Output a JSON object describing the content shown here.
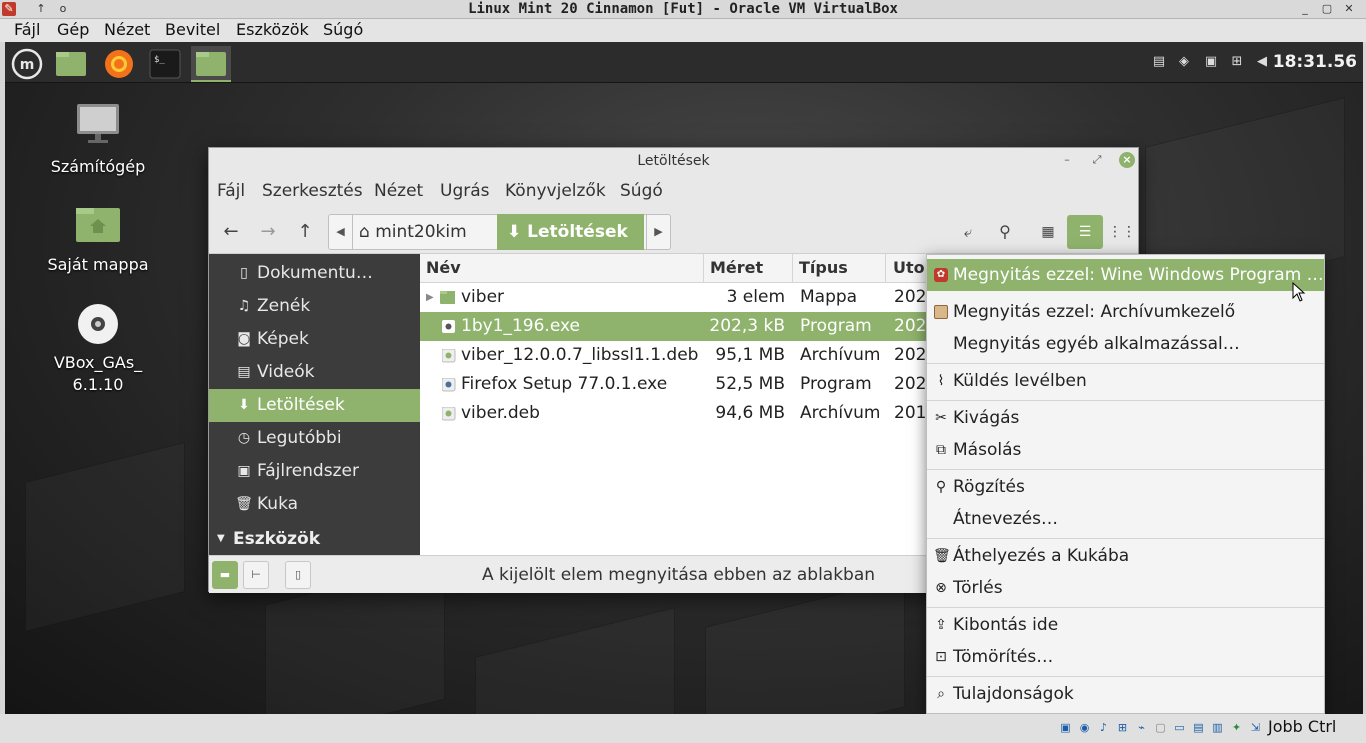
{
  "host": {
    "title": "Linux Mint 20 Cinnamon [Fut] - Oracle VM VirtualBox",
    "menu": [
      "Fájl",
      "Gép",
      "Nézet",
      "Bevitel",
      "Eszközök",
      "Súgó"
    ],
    "host_key": "Jobb Ctrl"
  },
  "panel": {
    "clock": "18:31.56"
  },
  "desktop": {
    "icons": [
      {
        "label": "Számítógép",
        "icon": "computer-icon"
      },
      {
        "label": "Saját mappa",
        "icon": "home-folder-icon"
      },
      {
        "label": "VBox_GAs_\n6.1.10",
        "line1": "VBox_GAs_",
        "line2": "6.1.10",
        "icon": "cdrom-icon"
      }
    ]
  },
  "nemo": {
    "title": "Letöltések",
    "menu": [
      "Fájl",
      "Szerkesztés",
      "Nézet",
      "Ugrás",
      "Könyvjelzők",
      "Súgó"
    ],
    "breadcrumb": {
      "home": "mint20kim",
      "current": "Letöltések"
    },
    "sidebar": [
      {
        "label": "Dokumentu…",
        "icon": "document-icon"
      },
      {
        "label": "Zenék",
        "icon": "music-icon"
      },
      {
        "label": "Képek",
        "icon": "camera-icon"
      },
      {
        "label": "Videók",
        "icon": "video-icon"
      },
      {
        "label": "Letöltések",
        "icon": "download-icon",
        "selected": true
      },
      {
        "label": "Legutóbbi",
        "icon": "recent-icon"
      },
      {
        "label": "Fájlrendszer",
        "icon": "drive-icon"
      },
      {
        "label": "Kuka",
        "icon": "trash-icon"
      }
    ],
    "sidebar_section": "Eszközök",
    "columns": [
      "Név",
      "Méret",
      "Típus",
      "Uto"
    ],
    "files": [
      {
        "name": "viber",
        "size": "3 elem",
        "type": "Mappa",
        "date": "202",
        "kind": "folder"
      },
      {
        "name": "1by1_196.exe",
        "size": "202,3 kB",
        "type": "Program",
        "date": "202",
        "kind": "exe",
        "selected": true
      },
      {
        "name": "viber_12.0.0.7_libssl1.1.deb",
        "size": "95,1 MB",
        "type": "Archívum",
        "date": "202",
        "kind": "deb"
      },
      {
        "name": "Firefox Setup 77.0.1.exe",
        "size": "52,5 MB",
        "type": "Program",
        "date": "202",
        "kind": "exe"
      },
      {
        "name": "viber.deb",
        "size": "94,6 MB",
        "type": "Archívum",
        "date": "201",
        "kind": "deb"
      }
    ],
    "status": "A kijelölt elem megnyitása ebben az ablakban"
  },
  "context_menu": {
    "items": [
      {
        "label": "Megnyitás ezzel: Wine Windows Program …",
        "icon": "wine-icon",
        "highlighted": true
      },
      {
        "label": "Megnyitás ezzel: Archívumkezelő",
        "icon": "archive-icon"
      },
      {
        "label": "Megnyitás egyéb alkalmazással…",
        "icon": ""
      },
      {
        "label": "Küldés levélben",
        "icon": "attachment-icon"
      },
      {
        "label": "Kivágás",
        "icon": "cut-icon"
      },
      {
        "label": "Másolás",
        "icon": "copy-icon"
      },
      {
        "label": "Rögzítés",
        "icon": "pin-icon"
      },
      {
        "label": "Átnevezés…",
        "icon": ""
      },
      {
        "label": "Áthelyezés a Kukába",
        "icon": "trash-icon"
      },
      {
        "label": "Törlés",
        "icon": "delete-icon"
      },
      {
        "label": "Kibontás ide",
        "icon": "extract-icon"
      },
      {
        "label": "Tömörítés…",
        "icon": "compress-icon"
      },
      {
        "label": "Tulajdonságok",
        "icon": "properties-icon"
      }
    ]
  },
  "colors": {
    "accent": "#8fb36d",
    "sidebar_bg": "#3c3c3c",
    "panel_bg": "#2c2c2c"
  }
}
